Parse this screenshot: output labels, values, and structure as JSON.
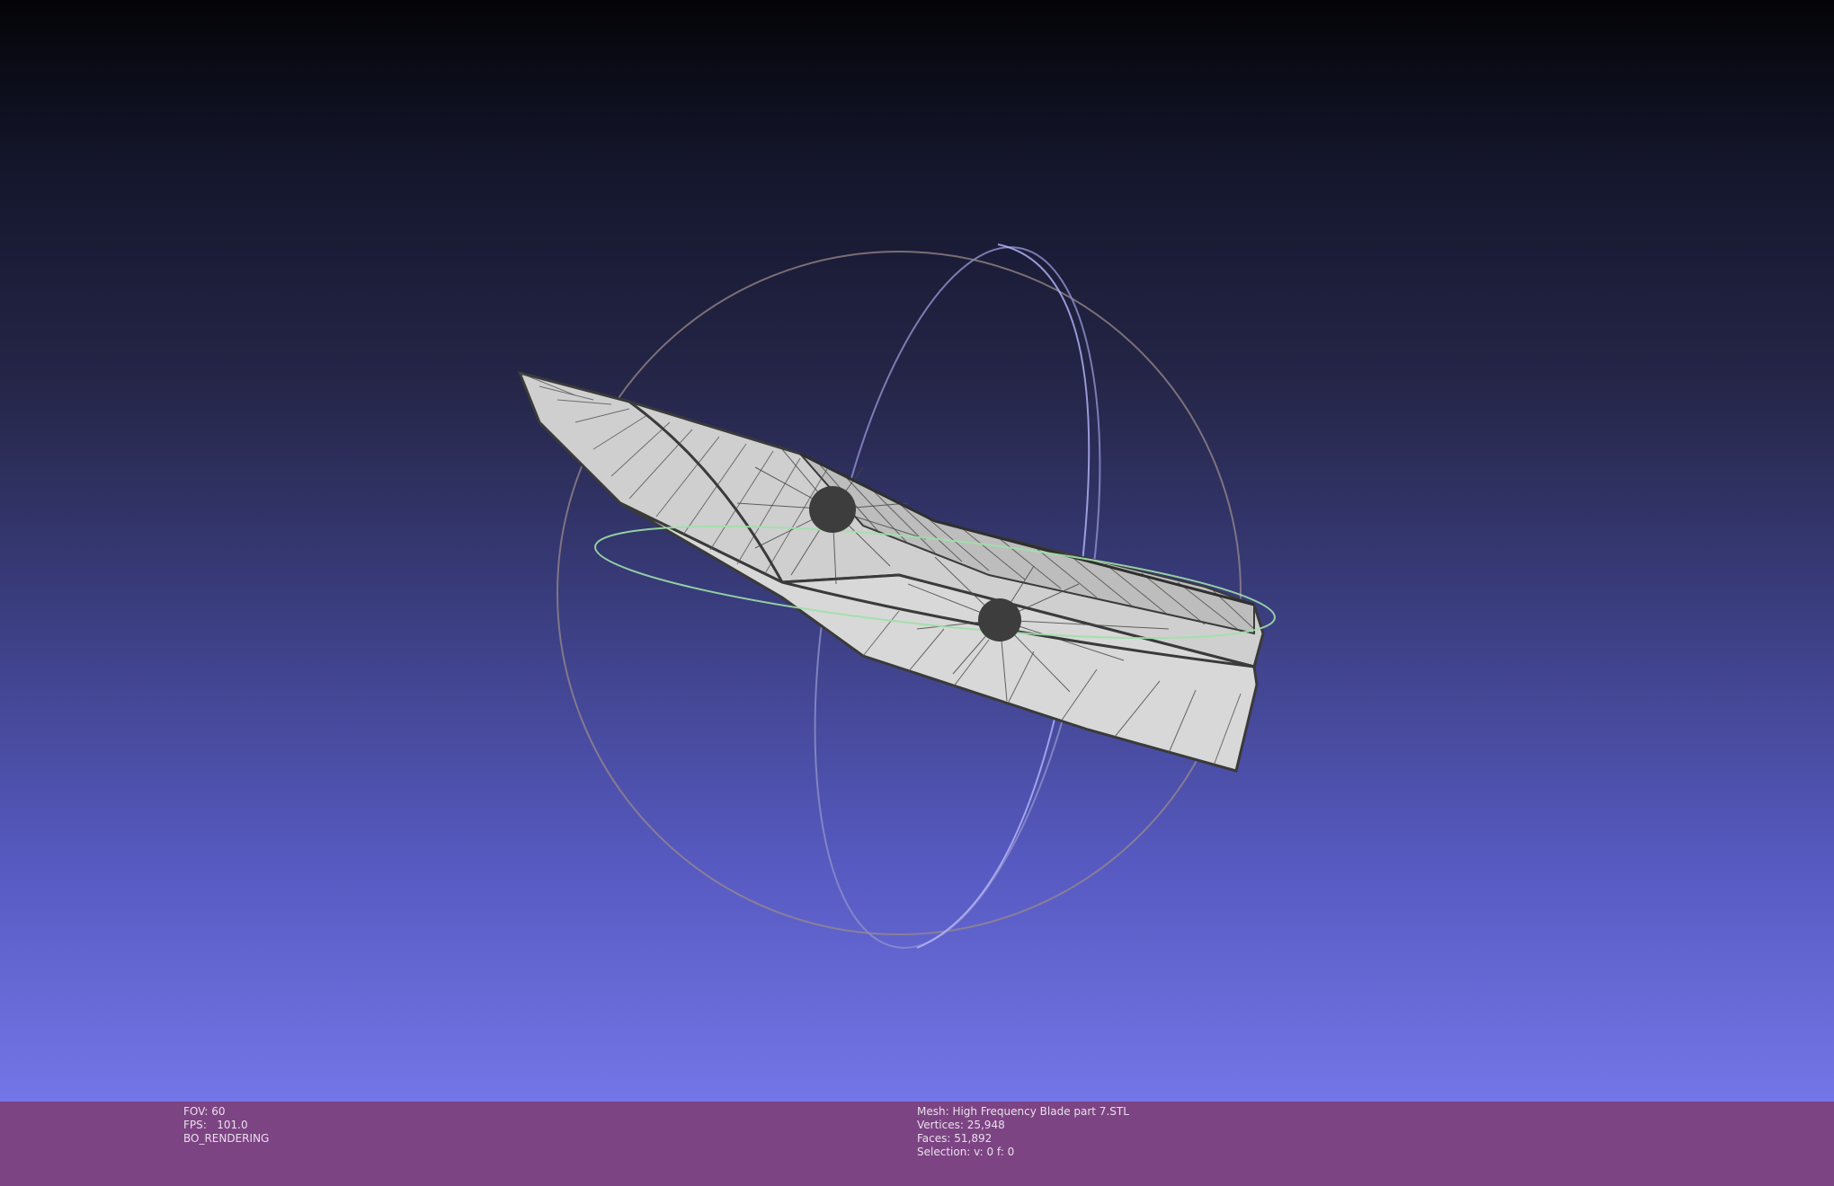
{
  "viewer": {
    "background_top_color": "#040407",
    "background_bottom_color": "#7476e8",
    "infobar_color": "#7d4483",
    "mesh_color": "#d4d4d4",
    "wire_color": "#3a3a3a",
    "trackball_x_ring_color": "#a8a8ff",
    "trackball_y_ring_color": "#9a9a9a",
    "trackball_z_ring_color": "#9fe0a8",
    "trackball_outer_color": "#9a8a8a"
  },
  "info_left": {
    "fov": "FOV: 60",
    "fps": "FPS:   101.0",
    "render_mode": "BO_RENDERING"
  },
  "info_right": {
    "mesh": "Mesh: High Frequency Blade part 7.STL",
    "vertices": "Vertices: 25,948",
    "faces": "Faces: 51,892",
    "selection": "Selection: v: 0 f: 0"
  }
}
